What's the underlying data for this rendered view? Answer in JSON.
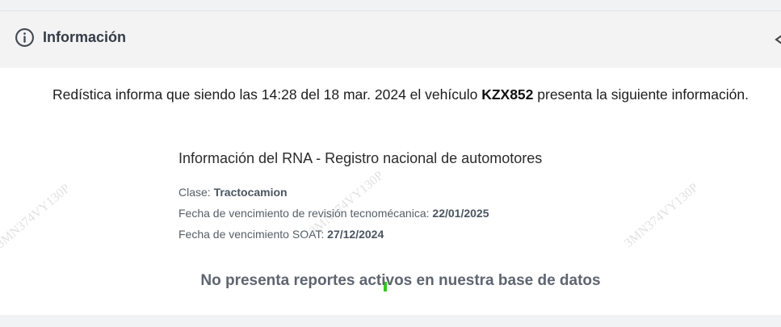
{
  "header": {
    "title": "Información",
    "icon": "info-circle-icon",
    "collapse_icon": "chevron-up-icon"
  },
  "intro": {
    "prefix": "Redística informa que siendo las 14:28 del 18 mar. 2024 el vehículo ",
    "plate": "KZX852",
    "suffix": " presenta la siguiente información."
  },
  "rna": {
    "title": "Información del RNA - Registro nacional de automotores",
    "fields": [
      {
        "label": "Clase: ",
        "value": "Tractocamion"
      },
      {
        "label": "Fecha de vencimiento de revisión tecnomécanica: ",
        "value": "22/01/2025"
      },
      {
        "label": "Fecha de vencimiento SOAT: ",
        "value": "27/12/2024"
      }
    ]
  },
  "status_message": "No presenta reportes activos en nuestra base de datos",
  "watermark": "3MN374VY130P",
  "colors": {
    "header_bg": "#f3f3f4",
    "body_bg": "#ffffff",
    "muted_text": "#5e6570"
  }
}
